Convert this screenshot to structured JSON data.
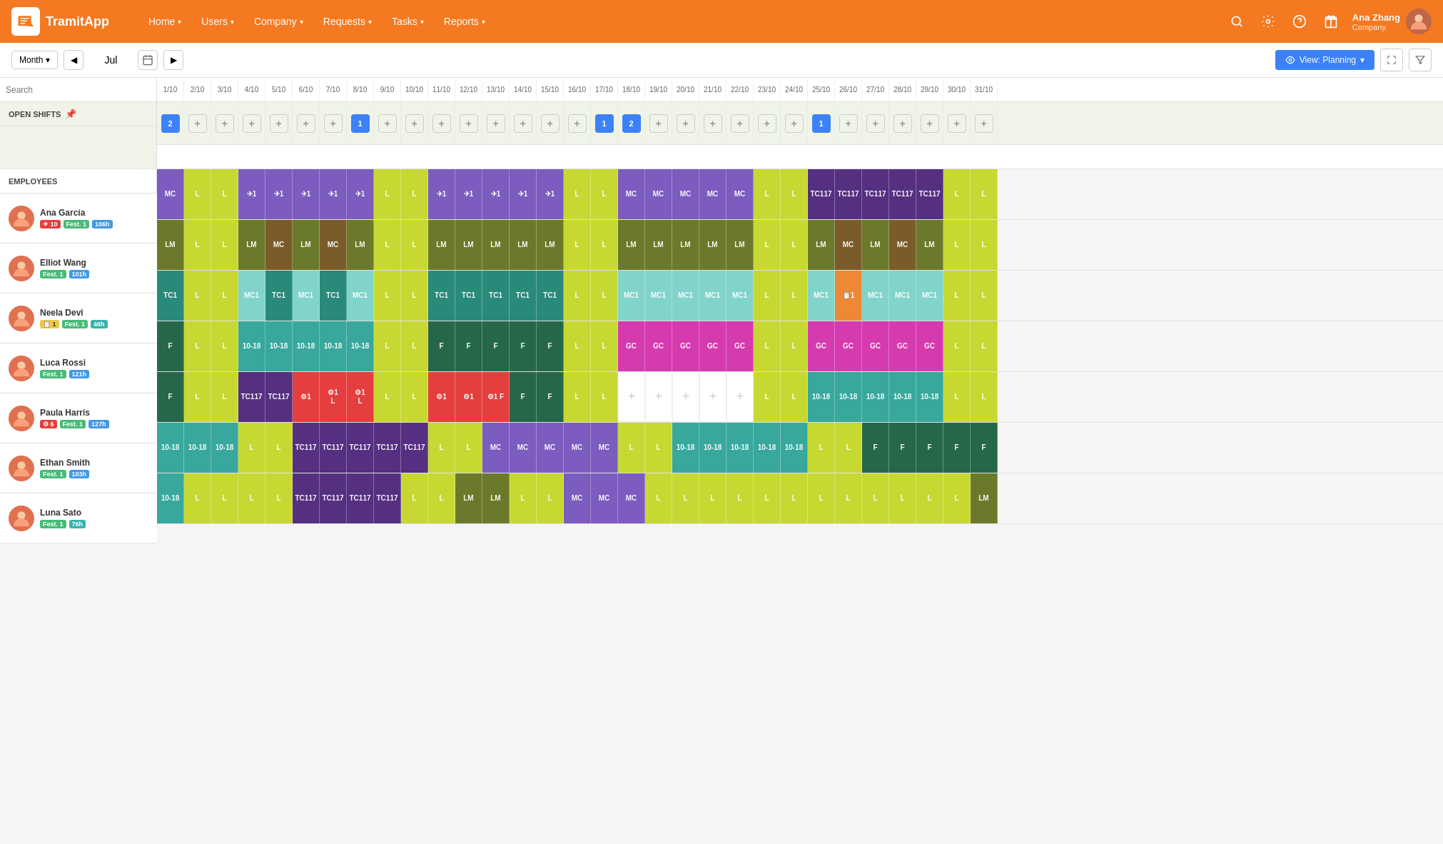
{
  "header": {
    "logo_text": "TramitApp",
    "nav_items": [
      {
        "label": "Home",
        "has_dropdown": true
      },
      {
        "label": "Users",
        "has_dropdown": true
      },
      {
        "label": "Company",
        "has_dropdown": true
      },
      {
        "label": "Requests",
        "has_dropdown": true
      },
      {
        "label": "Tasks",
        "has_dropdown": true
      },
      {
        "label": "Reports",
        "has_dropdown": true
      }
    ],
    "user": {
      "name": "Ana Zhang",
      "role": "Company"
    }
  },
  "toolbar": {
    "period_label": "Month",
    "current_month": "Jul",
    "view_button": "View: Planning"
  },
  "grid": {
    "search_placeholder": "Search",
    "open_shifts_label": "OPEN SHIFTS",
    "employees_label": "EMPLOYEES",
    "dates": [
      "1/10",
      "2/10",
      "3/10",
      "4/10",
      "5/10",
      "6/10",
      "7/10",
      "8/10",
      "9/10",
      "10/10",
      "11/10",
      "12/10",
      "13/10",
      "14/10",
      "15/10",
      "16/10",
      "17/10",
      "18/10",
      "19/10",
      "20/10",
      "21/10",
      "22/10",
      "23/10",
      "24/10",
      "25/10",
      "26/10",
      "27/10",
      "28/10",
      "29/10",
      "30/10",
      "31/10"
    ],
    "employees": [
      {
        "name": "Ana García",
        "badges": [
          {
            "text": "✈ 10",
            "type": "red"
          },
          {
            "text": "Fest. 1",
            "type": "green"
          },
          {
            "text": "106h",
            "type": "blue"
          }
        ],
        "schedule": [
          "MC",
          "L",
          "L",
          "✈1",
          "✈1",
          "✈1",
          "✈1",
          "✈1",
          "L",
          "L",
          "✈1",
          "✈1",
          "✈1",
          "✈1",
          "✈1",
          "L",
          "L",
          "MC",
          "MC",
          "MC",
          "MC",
          "MC",
          "L",
          "L",
          "TC117",
          "TC117",
          "TC117",
          "TC117",
          "TC117",
          "L",
          "L"
        ],
        "colors": [
          "purple",
          "lime",
          "lime",
          "purple",
          "purple",
          "purple",
          "purple",
          "purple",
          "lime",
          "lime",
          "purple",
          "purple",
          "purple",
          "purple",
          "purple",
          "lime",
          "lime",
          "purple",
          "purple",
          "purple",
          "purple",
          "purple",
          "lime",
          "lime",
          "dark-purple",
          "dark-purple",
          "dark-purple",
          "dark-purple",
          "dark-purple",
          "lime",
          "lime"
        ]
      },
      {
        "name": "Elliot Wang",
        "badges": [
          {
            "text": "Fest. 1",
            "type": "green"
          },
          {
            "text": "101h",
            "type": "blue"
          }
        ],
        "schedule": [
          "LM",
          "L",
          "L",
          "LM",
          "MC",
          "LM",
          "MC",
          "LM",
          "L",
          "L",
          "LM",
          "LM",
          "LM",
          "LM",
          "LM",
          "L",
          "L",
          "LM",
          "LM",
          "LM",
          "LM",
          "LM",
          "L",
          "L",
          "LM",
          "MC",
          "LM",
          "MC",
          "LM",
          "L",
          "L"
        ],
        "colors": [
          "dark-olive",
          "lime",
          "lime",
          "dark-olive",
          "brown",
          "dark-olive",
          "brown",
          "dark-olive",
          "lime",
          "lime",
          "dark-olive",
          "dark-olive",
          "dark-olive",
          "dark-olive",
          "dark-olive",
          "lime",
          "lime",
          "dark-olive",
          "dark-olive",
          "dark-olive",
          "dark-olive",
          "dark-olive",
          "lime",
          "lime",
          "dark-olive",
          "brown",
          "dark-olive",
          "brown",
          "dark-olive",
          "lime",
          "lime"
        ]
      },
      {
        "name": "Neela Devi",
        "badges": [
          {
            "text": "📋 1",
            "type": "yellow"
          },
          {
            "text": "Fest. 1",
            "type": "green"
          },
          {
            "text": "46h",
            "type": "teal"
          }
        ],
        "schedule": [
          "TC1",
          "L",
          "L",
          "MC1",
          "TC1",
          "MC1",
          "TC1",
          "MC1",
          "L",
          "L",
          "TC1",
          "TC1",
          "TC1",
          "TC1",
          "TC1",
          "L",
          "L",
          "MC1",
          "MC1",
          "MC1",
          "MC1",
          "MC1",
          "L",
          "L",
          "MC1",
          "📋1",
          "MC1",
          "MC1",
          "MC1",
          "L",
          "L"
        ],
        "colors": [
          "teal-dark",
          "lime",
          "lime",
          "light-teal",
          "teal-dark",
          "light-teal",
          "teal-dark",
          "light-teal",
          "lime",
          "lime",
          "teal-dark",
          "teal-dark",
          "teal-dark",
          "teal-dark",
          "teal-dark",
          "lime",
          "lime",
          "light-teal",
          "light-teal",
          "light-teal",
          "light-teal",
          "light-teal",
          "lime",
          "lime",
          "light-teal",
          "orange",
          "light-teal",
          "light-teal",
          "light-teal",
          "lime",
          "lime"
        ]
      },
      {
        "name": "Luca Rossi",
        "badges": [
          {
            "text": "Fest. 1",
            "type": "green"
          },
          {
            "text": "121h",
            "type": "blue"
          }
        ],
        "schedule": [
          "F",
          "L",
          "L",
          "10-18",
          "10-18",
          "10-18",
          "10-18",
          "10-18",
          "L",
          "L",
          "F",
          "F",
          "F",
          "F",
          "F",
          "L",
          "L",
          "GC",
          "GC",
          "GC",
          "GC",
          "GC",
          "L",
          "L",
          "GC",
          "GC",
          "GC",
          "GC",
          "GC",
          "L",
          "L"
        ],
        "colors": [
          "dark-green",
          "lime",
          "lime",
          "teal",
          "teal",
          "teal",
          "teal",
          "teal",
          "lime",
          "lime",
          "dark-green",
          "dark-green",
          "dark-green",
          "dark-green",
          "dark-green",
          "lime",
          "lime",
          "magenta",
          "magenta",
          "magenta",
          "magenta",
          "magenta",
          "lime",
          "lime",
          "magenta",
          "magenta",
          "magenta",
          "magenta",
          "magenta",
          "lime",
          "lime"
        ]
      },
      {
        "name": "Paula Harris",
        "badges": [
          {
            "text": "⚙ 6",
            "type": "red"
          },
          {
            "text": "Fest. 1",
            "type": "green"
          },
          {
            "text": "127h",
            "type": "blue"
          }
        ],
        "schedule": [
          "F",
          "L",
          "L",
          "TC117",
          "TC117",
          "⚙1",
          "⚙1 L",
          "⚙1 L",
          "L",
          "L",
          "⚙1",
          "⚙1",
          "⚙1 F",
          "F",
          "F",
          "L",
          "L",
          "+",
          "+",
          "+",
          "+",
          "+",
          "L",
          "L",
          "10-18",
          "10-18",
          "10-18",
          "10-18",
          "10-18",
          "L",
          "L"
        ],
        "colors": [
          "dark-green",
          "lime",
          "lime",
          "dark-purple",
          "dark-purple",
          "red",
          "red",
          "red",
          "lime",
          "lime",
          "red",
          "red",
          "red",
          "dark-green",
          "dark-green",
          "lime",
          "lime",
          "white",
          "white",
          "white",
          "white",
          "white",
          "lime",
          "lime",
          "teal",
          "teal",
          "teal",
          "teal",
          "teal",
          "lime",
          "lime"
        ]
      },
      {
        "name": "Ethan Smith",
        "badges": [
          {
            "text": "Fest. 1",
            "type": "green"
          },
          {
            "text": "103h",
            "type": "blue"
          }
        ],
        "schedule": [
          "10-18",
          "10-18",
          "10-18",
          "L",
          "L",
          "TC117",
          "TC117",
          "TC117",
          "TC117",
          "TC117",
          "L",
          "L",
          "MC",
          "MC",
          "MC",
          "MC",
          "MC",
          "L",
          "L",
          "10-18",
          "10-18",
          "10-18",
          "10-18",
          "10-18",
          "L",
          "L",
          "F",
          "F",
          "F",
          "F",
          "F"
        ],
        "colors": [
          "teal",
          "teal",
          "teal",
          "lime",
          "lime",
          "dark-purple",
          "dark-purple",
          "dark-purple",
          "dark-purple",
          "dark-purple",
          "lime",
          "lime",
          "purple",
          "purple",
          "purple",
          "purple",
          "purple",
          "lime",
          "lime",
          "teal",
          "teal",
          "teal",
          "teal",
          "teal",
          "lime",
          "lime",
          "dark-green",
          "dark-green",
          "dark-green",
          "dark-green",
          "dark-green"
        ]
      },
      {
        "name": "Luna Sato",
        "badges": [
          {
            "text": "Fest. 1",
            "type": "green"
          },
          {
            "text": "76h",
            "type": "teal"
          }
        ],
        "schedule": [
          "10-18",
          "L",
          "L",
          "L",
          "L",
          "TC117",
          "TC117",
          "TC117",
          "TC117",
          "L",
          "L",
          "LM",
          "LM",
          "L",
          "L",
          "MC",
          "MC",
          "MC",
          "L",
          "L",
          "L",
          "L",
          "L",
          "L",
          "L",
          "L",
          "L",
          "L",
          "L",
          "L",
          "LM"
        ],
        "colors": [
          "teal",
          "lime",
          "lime",
          "lime",
          "lime",
          "dark-purple",
          "dark-purple",
          "dark-purple",
          "dark-purple",
          "lime",
          "lime",
          "dark-olive",
          "dark-olive",
          "lime",
          "lime",
          "purple",
          "purple",
          "purple",
          "lime",
          "lime",
          "lime",
          "lime",
          "lime",
          "lime",
          "lime",
          "lime",
          "lime",
          "lime",
          "lime",
          "lime",
          "dark-olive"
        ]
      }
    ],
    "open_shifts_data": [
      {
        "day": 1,
        "count": 2
      },
      {
        "day": 8,
        "count": 1
      },
      {
        "day": 17,
        "count": 1
      },
      {
        "day": 18,
        "count": 2
      },
      {
        "day": 25,
        "count": 1
      }
    ]
  }
}
